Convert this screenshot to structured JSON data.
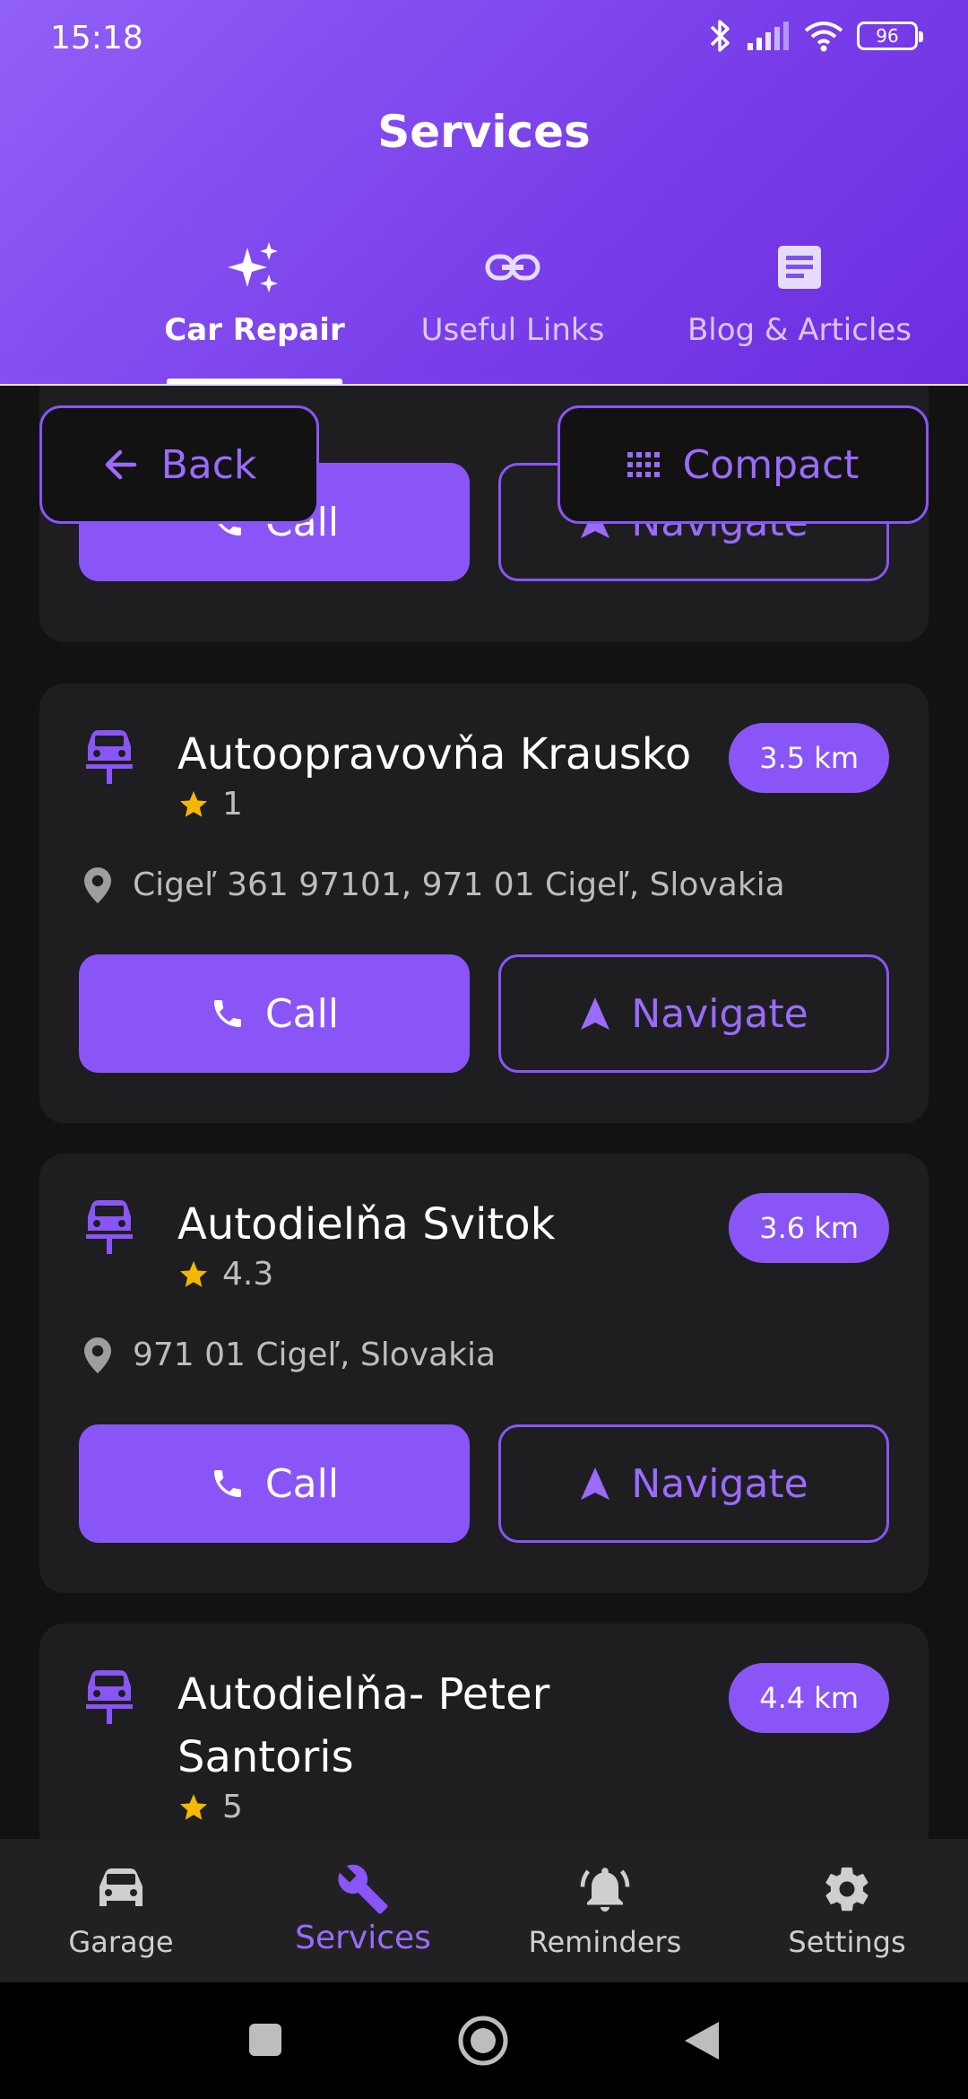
{
  "status": {
    "time": "15:18",
    "battery": "96"
  },
  "header": {
    "title": "Services"
  },
  "tabs": [
    {
      "label": "Car Repair",
      "icon": "sparkles-icon",
      "active": true
    },
    {
      "label": "Useful Links",
      "icon": "link-icon",
      "active": false
    },
    {
      "label": "Blog & Articles",
      "icon": "article-icon",
      "active": false
    }
  ],
  "actions": {
    "back_label": "Back",
    "compact_label": "Compact"
  },
  "cards": [
    {
      "call_label": "Call",
      "navigate_label": "Navigate"
    },
    {
      "title": "Autoopravovňa Krausko",
      "distance": "3.5 km",
      "rating": "1",
      "address": "Cigeľ 361 97101, 971 01 Cigeľ, Slovakia",
      "call_label": "Call",
      "navigate_label": "Navigate"
    },
    {
      "title": "Autodielňa Svitok",
      "distance": "3.6 km",
      "rating": "4.3",
      "address": "971 01 Cigeľ, Slovakia",
      "call_label": "Call",
      "navigate_label": "Navigate"
    },
    {
      "title_line1": "Autodielňa- Peter",
      "title_line2": "Santoris",
      "distance": "4.4 km",
      "rating": "5"
    }
  ],
  "bottom_nav": [
    {
      "label": "Garage",
      "icon": "car-icon"
    },
    {
      "label": "Services",
      "icon": "wrench-icon",
      "active": true
    },
    {
      "label": "Reminders",
      "icon": "bell-icon"
    },
    {
      "label": "Settings",
      "icon": "gear-icon"
    }
  ],
  "colors": {
    "accent": "#8a55f7",
    "header_start": "#9160f6",
    "header_end": "#6c2de0",
    "background": "#121212",
    "card": "#1e1e20",
    "star": "#f5b800"
  }
}
